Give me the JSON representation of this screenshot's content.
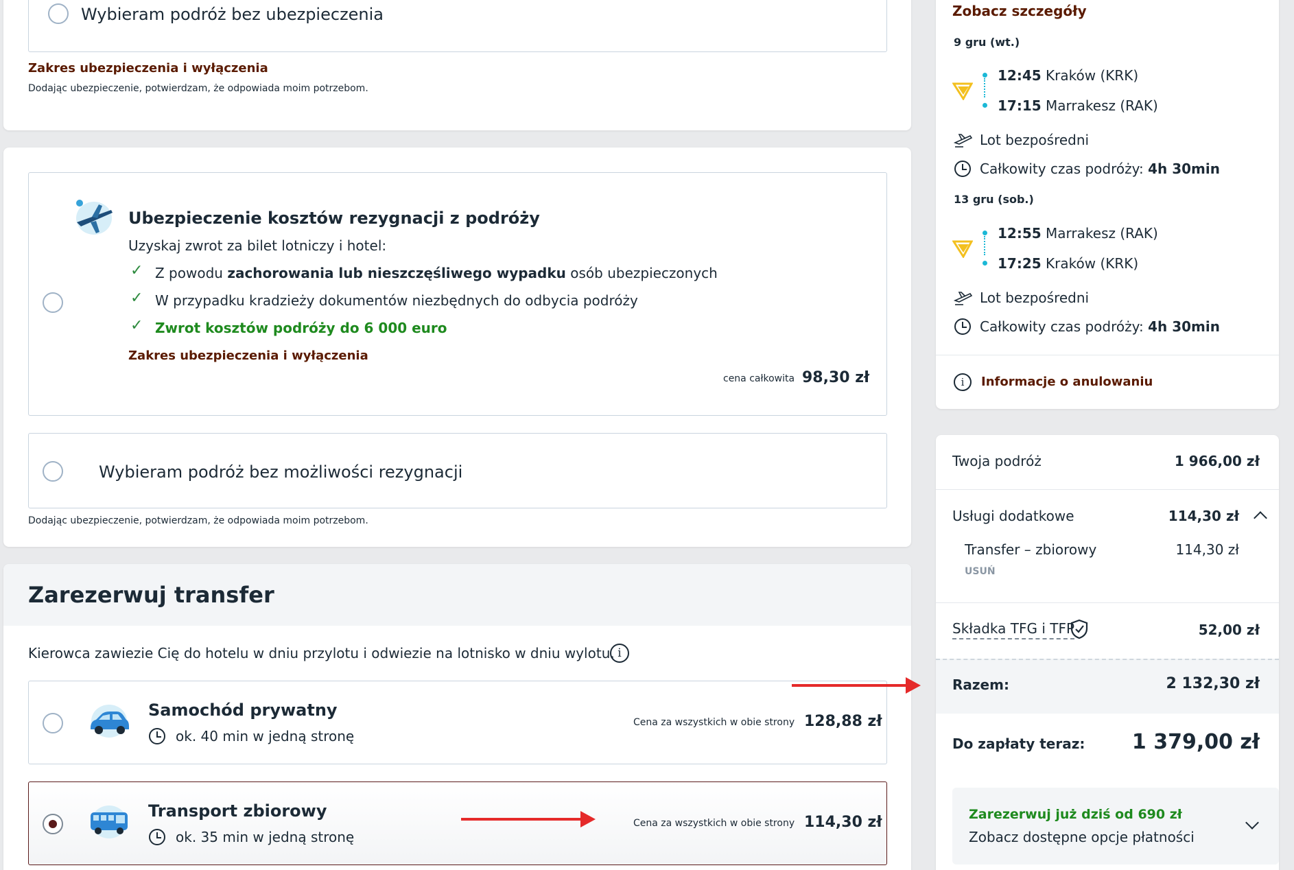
{
  "insurance_top": {
    "no_insurance_label": "Wybieram podróż bez ubezpieczenia",
    "scope_link": "Zakres ubezpieczenia i wyłączenia",
    "confirm_text": "Dodając ubezpieczenie, potwierdzam, że odpowiada moim potrzebom."
  },
  "cancellation": {
    "title": "Ubezpieczenie kosztów rezygnacji z podróży",
    "subtitle": "Uzyskaj zwrot za bilet lotniczy i hotel:",
    "bullet1_pre": "Z powodu ",
    "bullet1_bold": "zachorowania lub nieszczęśliwego wypadku",
    "bullet1_post": " osób ubezpieczonych",
    "bullet2": "W przypadku kradzieży dokumentów niezbędnych do odbycia podróży",
    "bullet3": "Zwrot kosztów podróży do 6 000 euro",
    "scope_link": "Zakres ubezpieczenia i wyłączenia",
    "price_label": "cena całkowita",
    "price": "98,30 zł",
    "no_cancel_label": "Wybieram podróż bez możliwości rezygnacji",
    "confirm_text": "Dodając ubezpieczenie, potwierdzam, że odpowiada moim potrzebom."
  },
  "transfer": {
    "title": "Zarezerwuj transfer",
    "description": "Kierowca zawiezie Cię do hotelu w dniu przylotu i odwiezie na lotnisko w dniu wylotu.",
    "options": [
      {
        "name": "Samochód prywatny",
        "duration": "ok. 40 min w jedną stronę",
        "price_label": "Cena za wszystkich w obie strony",
        "price": "128,88 zł",
        "selected": false
      },
      {
        "name": "Transport zbiorowy",
        "duration": "ok. 35 min w jedną stronę",
        "price_label": "Cena za wszystkich w obie strony",
        "price": "114,30 zł",
        "selected": true
      }
    ]
  },
  "flights": {
    "details_link": "Zobacz szczegóły",
    "legs": [
      {
        "date": "9 gru (wt.)",
        "dep_time": "12:45",
        "dep_place": "Kraków (KRK)",
        "arr_time": "17:15",
        "arr_place": "Marrakesz (RAK)",
        "type": "Lot bezpośredni",
        "duration_label": "Całkowity czas podróży:",
        "duration": "4h 30min"
      },
      {
        "date": "13 gru (sob.)",
        "dep_time": "12:55",
        "dep_place": "Marrakesz (RAK)",
        "arr_time": "17:25",
        "arr_place": "Kraków (KRK)",
        "type": "Lot bezpośredni",
        "duration_label": "Całkowity czas podróży:",
        "duration": "4h 30min"
      }
    ],
    "cancel_info_link": "Informacje o anulowaniu"
  },
  "summary": {
    "trip_label": "Twoja podróż",
    "trip_value": "1 966,00 zł",
    "extras_label": "Usługi dodatkowe",
    "extras_value": "114,30 zł",
    "extra_item_label": "Transfer – zbiorowy",
    "extra_item_value": "114,30 zł",
    "remove_label": "USUŃ",
    "fee_label": "Składka TFG i TFP",
    "fee_value": "52,00 zł",
    "total_label": "Razem:",
    "total_value": "2 132,30 zł",
    "pay_now_label": "Do zapłaty teraz:",
    "pay_now_value": "1 379,00 zł",
    "promo_title": "Zarezerwuj już dziś od 690 zł",
    "promo_subtitle": "Zobacz dostępne opcje płatności"
  },
  "colors": {
    "accent_dark_red": "#5a1a00",
    "green": "#1e8a1e",
    "cyan": "#1bb8d6",
    "arrow_red": "#e52a2a"
  }
}
